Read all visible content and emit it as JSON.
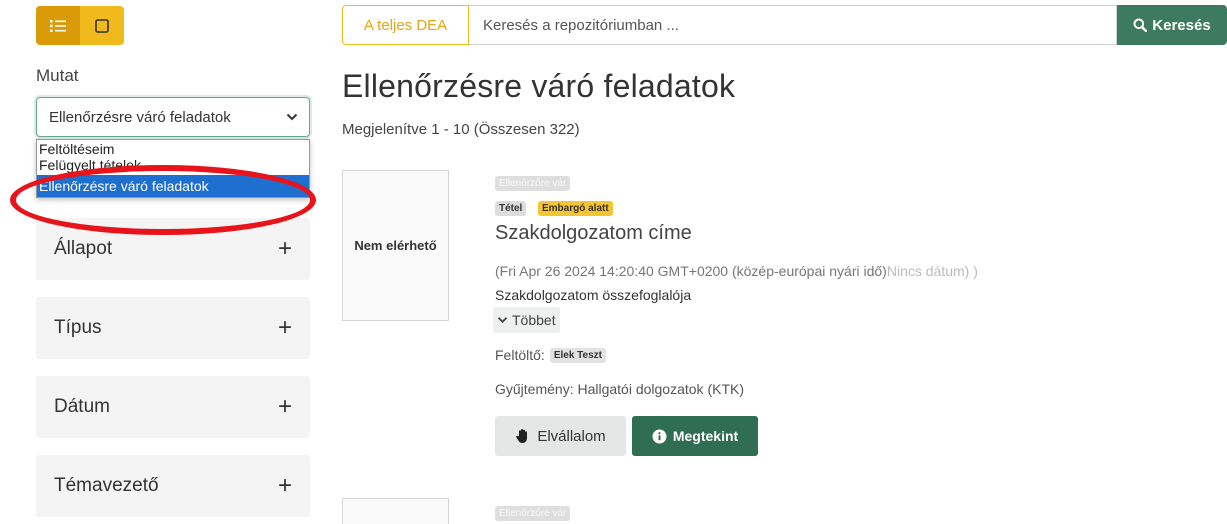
{
  "colors": {
    "accent_yellow": "#f0b91c",
    "accent_yellow_dark": "#d99b07",
    "accent_green": "#3d7a5f",
    "button_green": "#2f6e52",
    "select_highlight": "#1e6fd0",
    "annotation_red": "#e8141b"
  },
  "view_toggle": {
    "list_icon": "list-icon",
    "grid_icon": "square-icon"
  },
  "sidebar": {
    "show_label": "Mutat",
    "select": {
      "value": "Ellenőrzésre váró feladatok",
      "options": [
        "Feltöltéseim",
        "Felügyelt tételek",
        "Ellenőrzésre váró feladatok"
      ]
    },
    "facets": [
      {
        "label": "Állapot",
        "toggle": "+"
      },
      {
        "label": "Típus",
        "toggle": "+"
      },
      {
        "label": "Dátum",
        "toggle": "+"
      },
      {
        "label": "Témavezető",
        "toggle": "+"
      }
    ]
  },
  "search": {
    "scope_label": "A teljes DEA",
    "placeholder": "Keresés a repozitóriumban ...",
    "button_label": "Keresés"
  },
  "main": {
    "title": "Ellenőrzésre váró feladatok",
    "showing": "Megjelenítve 1 - 10 (Összesen 322)",
    "items": [
      {
        "thumbnail_text": "Nem elérhető",
        "status_badge": "Ellenőrzőre vár",
        "type_badge": "Tétel",
        "embargo_badge": "Embargó alatt",
        "title": "Szakdolgozatom címe",
        "date": "(Fri Apr 26 2024 14:20:40 GMT+0200 (közép-európai nyári idő)",
        "date_tail": "Nincs dátum)",
        "date_tail_cut": ")",
        "abstract": "Szakdolgozatom összefoglalója",
        "more_label": "Többet",
        "uploader_label": "Feltöltő:",
        "uploader_name": "Elek Teszt",
        "collection": "Gyűjtemény: Hallgatói dolgozatok (KTK)",
        "claim_label": "Elvállalom",
        "view_label": "Megtekint"
      },
      {
        "status_badge": "Ellenőrzőre vár"
      }
    ]
  }
}
